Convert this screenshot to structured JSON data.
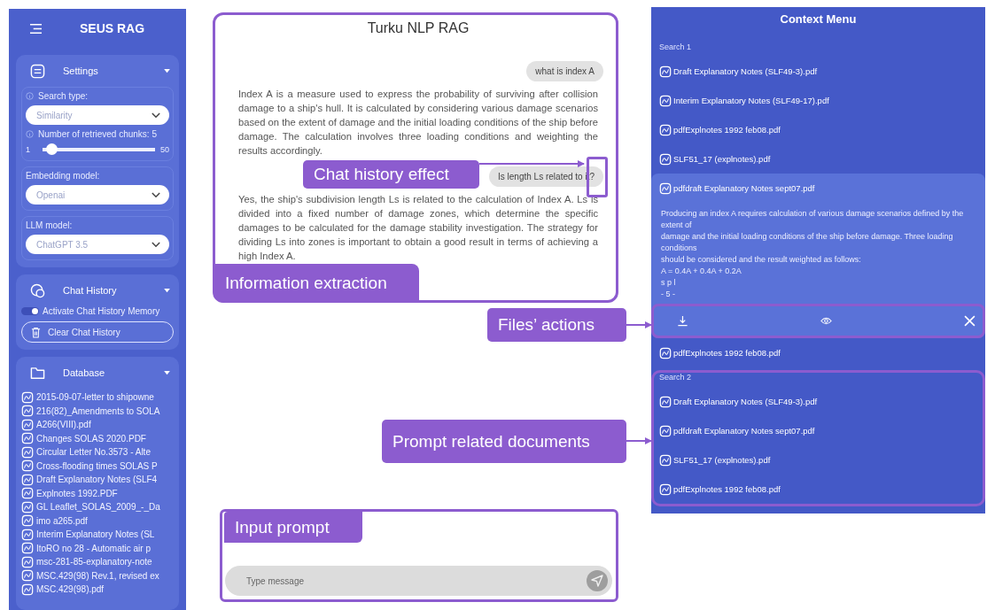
{
  "sidebar": {
    "title": "SEUS RAG",
    "settings": {
      "label": "Settings",
      "expanded": true,
      "search_type": {
        "label": "Search type:",
        "value": "Similarity"
      },
      "chunks": {
        "label": "Number of retrieved chunks: 5",
        "min": "1",
        "max": "50",
        "level": 0.08
      },
      "embedding_model": {
        "label": "Embedding model:",
        "value": "Openai"
      },
      "llm_model": {
        "label": "LLM model:",
        "value": "ChatGPT 3.5"
      }
    },
    "chat_history": {
      "label": "Chat History",
      "expanded": true,
      "memory_toggle": {
        "label": "Activate Chat History Memory",
        "on": true
      },
      "clear_button": "Clear Chat History"
    },
    "database": {
      "label": "Database",
      "expanded": true,
      "files": [
        "2015-09-07-letter to shipowne",
        "216(82)_Amendments to SOLA",
        "A266(VIII).pdf",
        "Changes SOLAS 2020.PDF",
        "Circular Letter No.3573 - Alte",
        "Cross-flooding times SOLAS P",
        "Draft Explanatory Notes (SLF4",
        "Explnotes 1992.PDF",
        "GL Leaflet_SOLAS_2009_-_Da",
        "imo a265.pdf",
        "Interim Explanatory Notes (SL",
        "ItoRO no 28 - Automatic air p",
        "msc-281-85-explanatory-note",
        "MSC.429(98) Rev.1, revised ex",
        "MSC.429(98).pdf"
      ]
    }
  },
  "chat": {
    "title": "Turku NLP RAG",
    "messages": [
      {
        "kind": "question",
        "text": "what is index A"
      },
      {
        "kind": "answer",
        "text": "Index A is a measure used to express the probability of surviving after collision damage to a ship's hull. It is calculated by considering various damage scenarios based on the extent of damage and the initial loading conditions of the ship before damage. The calculation involves three loading conditions and weighting the results accordingly."
      },
      {
        "kind": "question",
        "text": "Is length Ls related to it?"
      },
      {
        "kind": "answer",
        "text": "Yes, the ship's subdivision length Ls is related to the calculation of Index A. Ls is divided into a fixed number of damage zones, which determine the specific damages to be calculated for the damage stability investigation. The strategy for dividing Ls into zones is important to obtain a good result in terms of achieving a high Index A."
      }
    ]
  },
  "input": {
    "placeholder": "Type message"
  },
  "context_menu": {
    "title": "Context Menu",
    "searches": [
      {
        "label": "Search 1",
        "files": [
          {
            "name": "Draft Explanatory Notes (SLF49-3).pdf",
            "expanded": false
          },
          {
            "name": "Interim Explanatory Notes (SLF49-17).pdf",
            "expanded": false
          },
          {
            "name": "pdfExplnotes 1992 feb08.pdf",
            "expanded": false
          },
          {
            "name": "SLF51_17 (explnotes).pdf",
            "expanded": false
          },
          {
            "name": "pdfdraft Explanatory Notes sept07.pdf",
            "expanded": true,
            "excerpt": [
              "Producing an index A requires calculation of various damage scenarios defined by the extent of",
              "damage and the initial loading conditions of the ship before damage. Three loading conditions",
              "should be considered and the result weighted as follows:",
              "A = 0.4A + 0.4A + 0.2A",
              "s p l",
              "- 5 -"
            ]
          },
          {
            "name": "pdfExplnotes 1992 feb08.pdf",
            "expanded": false
          }
        ]
      },
      {
        "label": "Search 2",
        "files": [
          {
            "name": "Draft Explanatory Notes (SLF49-3).pdf",
            "expanded": false
          },
          {
            "name": "pdfdraft Explanatory Notes sept07.pdf",
            "expanded": false
          },
          {
            "name": "SLF51_17 (explnotes).pdf",
            "expanded": false
          },
          {
            "name": "pdfExplnotes 1992 feb08.pdf",
            "expanded": false
          }
        ]
      }
    ]
  },
  "annotations": [
    {
      "kind": "chat_history",
      "text": "Chat history effect"
    },
    {
      "kind": "information_extraction",
      "text": "Information extraction"
    },
    {
      "kind": "files_actions",
      "text": "Files’ actions"
    },
    {
      "kind": "prompt_documents",
      "text": "Prompt related documents"
    },
    {
      "kind": "input_prompt",
      "text": "Input prompt"
    }
  ]
}
